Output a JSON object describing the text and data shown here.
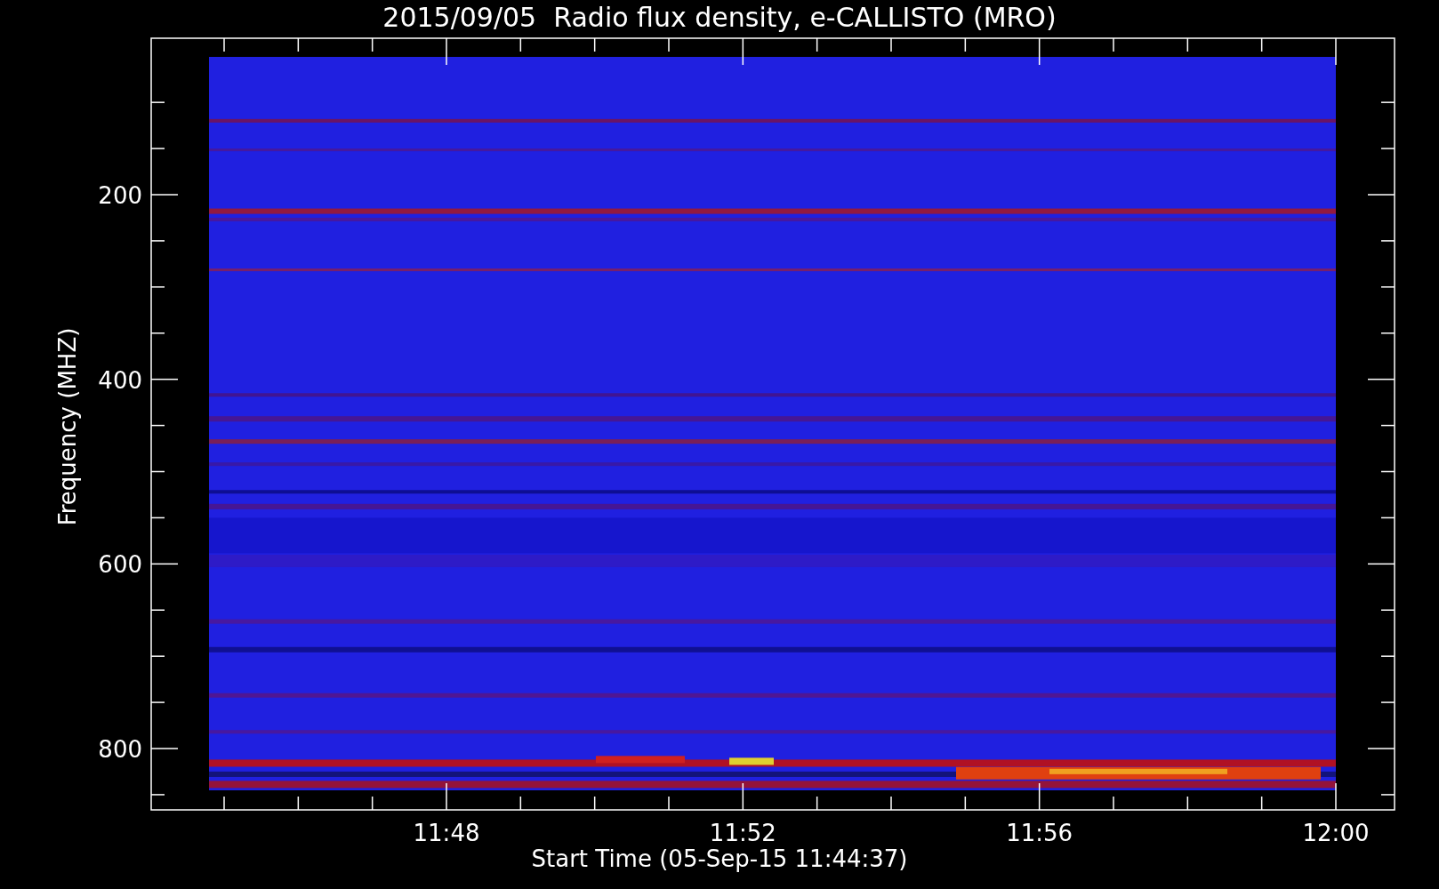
{
  "title": "2015/09/05  Radio flux density, e-CALLISTO (MRO)",
  "y_axis": {
    "label": "Frequency (MHZ)",
    "ticks": [
      "200",
      "400",
      "600",
      "800"
    ]
  },
  "x_axis": {
    "label": "Start Time (05-Sep-15 11:44:37)",
    "ticks": [
      "11:48",
      "11:52",
      "11:56",
      "12:00"
    ]
  }
}
